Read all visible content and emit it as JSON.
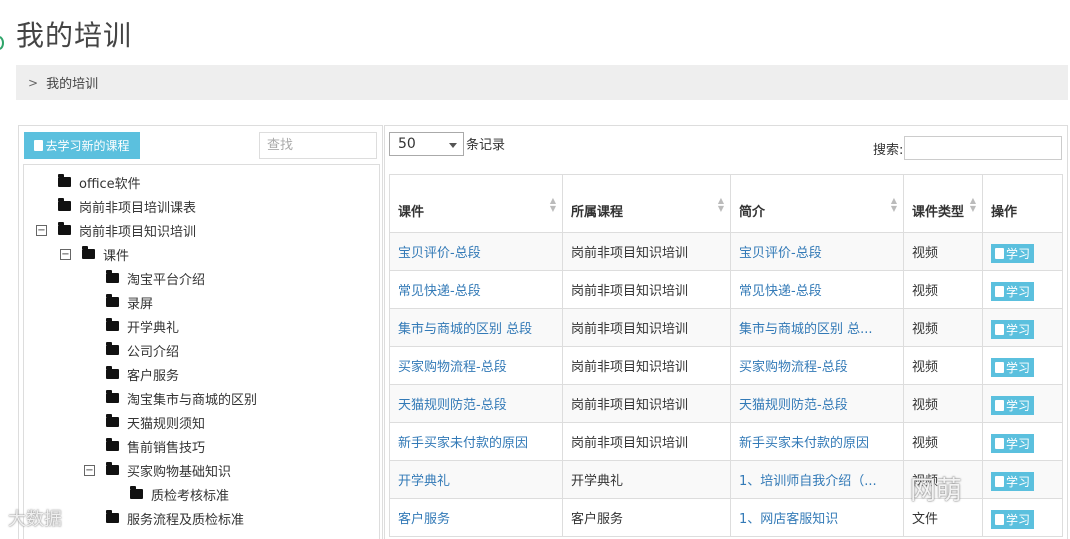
{
  "page": {
    "title": "我的培训"
  },
  "breadcrumb": {
    "items": [
      "我的培训"
    ]
  },
  "left": {
    "learn_button": "去学习新的课程",
    "search_placeholder": "查找",
    "tree": [
      {
        "label": "office软件",
        "level": 0,
        "toggle": ""
      },
      {
        "label": "岗前非项目培训课表",
        "level": 0,
        "toggle": ""
      },
      {
        "label": "岗前非项目知识培训",
        "level": 0,
        "toggle": "−"
      },
      {
        "label": "课件",
        "level": 1,
        "toggle": "−"
      },
      {
        "label": "淘宝平台介绍",
        "level": 2,
        "toggle": ""
      },
      {
        "label": "录屏",
        "level": 2,
        "toggle": ""
      },
      {
        "label": "开学典礼",
        "level": 2,
        "toggle": ""
      },
      {
        "label": "公司介绍",
        "level": 2,
        "toggle": ""
      },
      {
        "label": "客户服务",
        "level": 2,
        "toggle": ""
      },
      {
        "label": "淘宝集市与商城的区别",
        "level": 2,
        "toggle": ""
      },
      {
        "label": "天猫规则须知",
        "level": 2,
        "toggle": ""
      },
      {
        "label": "售前销售技巧",
        "level": 2,
        "toggle": ""
      },
      {
        "label": "买家购物基础知识",
        "level": 2,
        "toggle": "−"
      },
      {
        "label": "质检考核标准",
        "level": 3,
        "toggle": ""
      },
      {
        "label": "服务流程及质检标准",
        "level": 2,
        "toggle": ""
      }
    ]
  },
  "right": {
    "page_length": "50",
    "page_length_suffix": "条记录",
    "search_label": "搜索:",
    "columns": [
      "课件",
      "所属课程",
      "简介",
      "课件类型",
      "操作"
    ],
    "action_label": "学习",
    "rows": [
      [
        "宝贝评价-总段",
        "岗前非项目知识培训",
        "宝贝评价-总段",
        "视频"
      ],
      [
        "常见快递-总段",
        "岗前非项目知识培训",
        "常见快递-总段",
        "视频"
      ],
      [
        "集市与商城的区别 总段",
        "岗前非项目知识培训",
        "集市与商城的区别 总...",
        "视频"
      ],
      [
        "买家购物流程-总段",
        "岗前非项目知识培训",
        "买家购物流程-总段",
        "视频"
      ],
      [
        "天猫规则防范-总段",
        "岗前非项目知识培训",
        "天猫规则防范-总段",
        "视频"
      ],
      [
        "新手买家未付款的原因",
        "岗前非项目知识培训",
        "新手买家未付款的原因",
        "视频"
      ],
      [
        "开学典礼",
        "开学典礼",
        "1、培训师自我介绍（...",
        "视频"
      ],
      [
        "客户服务",
        "客户服务",
        "1、网店客服知识",
        "文件"
      ]
    ]
  },
  "watermarks": {
    "left": "大数据",
    "right": "网萌"
  },
  "colors": {
    "accent": "#5bc0de",
    "link": "#337ab7"
  }
}
